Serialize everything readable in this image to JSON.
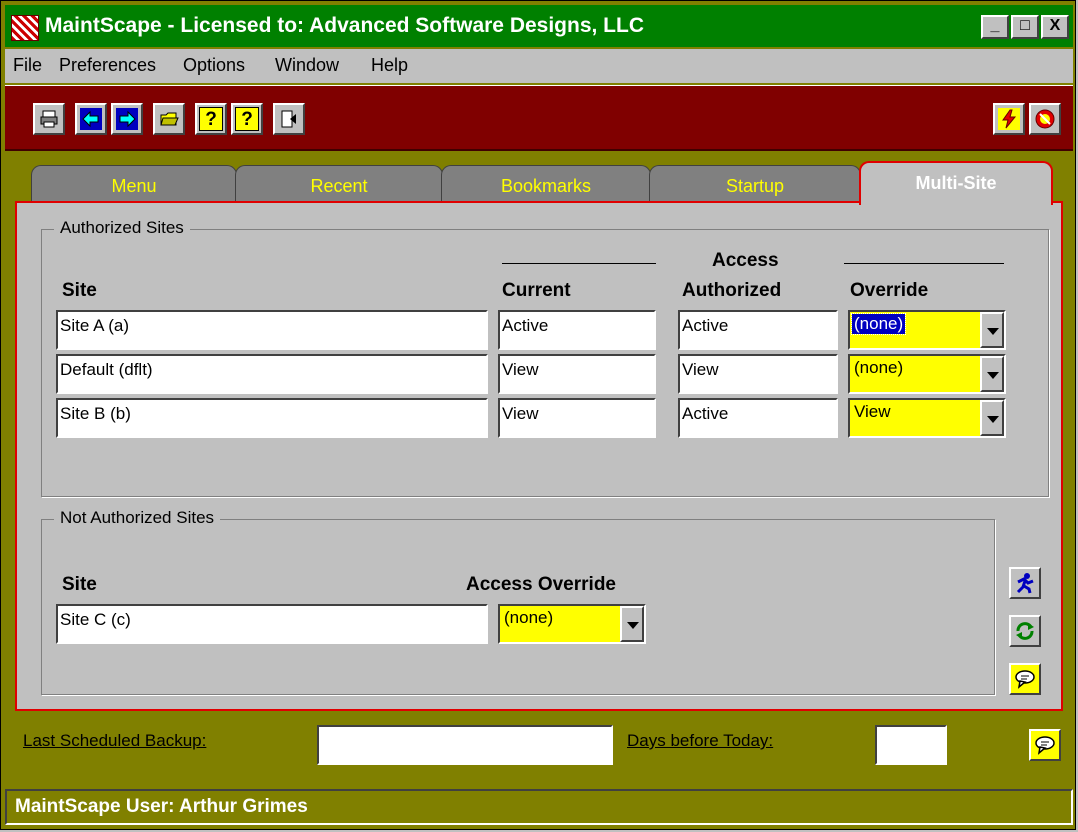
{
  "window": {
    "title": "MaintScape - Licensed to: Advanced Software Designs, LLC",
    "min_label": "_",
    "max_label": "□",
    "close_label": "X"
  },
  "menu": [
    {
      "label": "File"
    },
    {
      "label": "Preferences"
    },
    {
      "label": "Options"
    },
    {
      "label": "Window"
    },
    {
      "label": "Help"
    }
  ],
  "toolbar": {
    "icons": [
      "print-icon",
      "back-icon",
      "forward-icon",
      "open-folder-icon",
      "help-icon",
      "context-help-icon",
      "exit-icon",
      "lightning-icon",
      "stop-icon"
    ],
    "help_glyph": "?",
    "context_help_glyph": "?"
  },
  "tabs": [
    {
      "label": "Menu",
      "active": false
    },
    {
      "label": "Recent",
      "active": false
    },
    {
      "label": "Bookmarks",
      "active": false
    },
    {
      "label": "Startup",
      "active": false
    },
    {
      "label": "Multi-Site",
      "active": true
    }
  ],
  "authorized": {
    "group_label": "Authorized Sites",
    "headers": {
      "site": "Site",
      "current": "Current",
      "access_line1": "Access",
      "access_line2": "Authorized",
      "override": "Override"
    },
    "rows": [
      {
        "site": "Site A (a)",
        "current": "Active",
        "access": "Active",
        "override": "(none)",
        "selected": true
      },
      {
        "site": "Default (dflt)",
        "current": "View",
        "access": "View",
        "override": "(none)",
        "selected": false
      },
      {
        "site": "Site B (b)",
        "current": "View",
        "access": "Active",
        "override": "View",
        "selected": false
      }
    ]
  },
  "not_authorized": {
    "group_label": "Not Authorized Sites",
    "headers": {
      "site": "Site",
      "access_override": "Access Override"
    },
    "rows": [
      {
        "site": "Site C (c)",
        "access_override": "(none)"
      }
    ]
  },
  "side_buttons": [
    "run-icon",
    "refresh-icon",
    "comment-icon"
  ],
  "bottom": {
    "last_backup_label": "Last Scheduled Backup:",
    "last_backup_value": "",
    "days_label": "Days before Today:",
    "days_value": ""
  },
  "status": {
    "text": "MaintScape User: Arthur Grimes"
  },
  "colors": {
    "title_bar": "#008000",
    "toolbar": "#800000",
    "frame": "#808000",
    "tab_text": "#ffff00",
    "active_tab_border": "#e00000",
    "combo_bg": "#ffff00",
    "selection": "#0000c0"
  }
}
